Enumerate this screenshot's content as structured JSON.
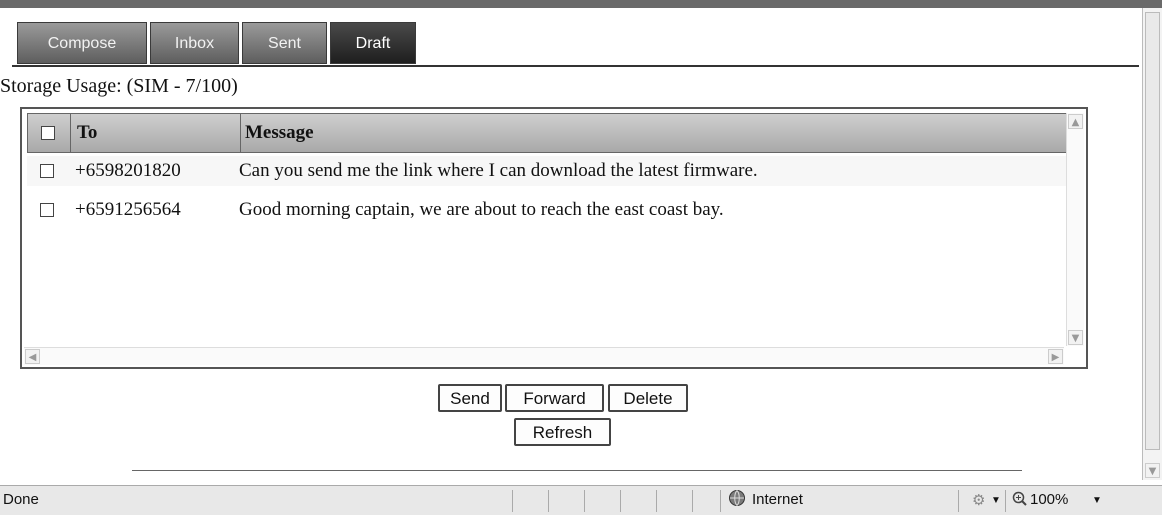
{
  "tabs": [
    {
      "label": "Compose",
      "active": false
    },
    {
      "label": "Inbox",
      "active": false
    },
    {
      "label": "Sent",
      "active": false
    },
    {
      "label": "Draft",
      "active": true
    }
  ],
  "storage_usage": "Storage Usage: (SIM - 7/100)",
  "table": {
    "headers": [
      "To",
      "Message"
    ],
    "rows": [
      {
        "to": "+6598201820",
        "message": "Can you send me the link where I can download the latest firmware."
      },
      {
        "to": "+6591256564",
        "message": "Good morning captain, we are about to reach the east coast bay."
      }
    ]
  },
  "buttons": {
    "send": "Send",
    "forward": "Forward",
    "delete": "Delete",
    "refresh": "Refresh"
  },
  "statusbar": {
    "status": "Done",
    "zone": "Internet",
    "zoom": "100%"
  },
  "icons": [
    "globe-icon",
    "security-icon",
    "zoom-icon",
    "dropdown-arrow-icon",
    "scroll-up-icon",
    "scroll-down-icon",
    "scroll-left-icon",
    "scroll-right-icon"
  ]
}
